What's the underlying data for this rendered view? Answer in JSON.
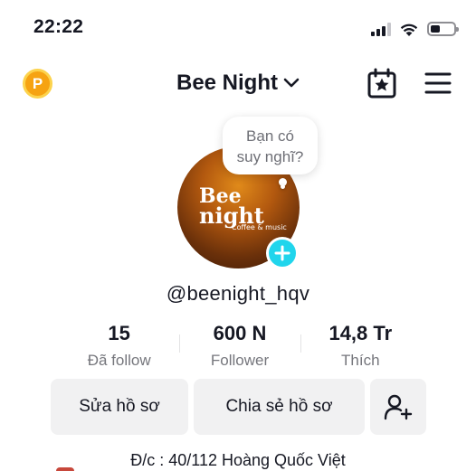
{
  "status_bar": {
    "time": "22:22"
  },
  "header": {
    "coin_letter": "P",
    "title": "Bee Night"
  },
  "bubble": {
    "line1": "Bạn có",
    "line2": "suy nghĩ?"
  },
  "avatar": {
    "logo_top": "Bee",
    "logo_bottom": "night",
    "logo_sub": "Coffee & music"
  },
  "profile": {
    "username": "@beenight_hqv"
  },
  "stats": [
    {
      "value": "15",
      "label": "Đã follow"
    },
    {
      "value": "600 N",
      "label": "Follower"
    },
    {
      "value": "14,8 Tr",
      "label": "Thích"
    }
  ],
  "buttons": {
    "edit": "Sửa hồ sơ",
    "share": "Chia sẻ hồ sơ"
  },
  "bio": "Đ/c : 40/112 Hoàng Quốc Việt",
  "colors": {
    "accent": "#20d5ec",
    "coin": "#f6a312"
  }
}
